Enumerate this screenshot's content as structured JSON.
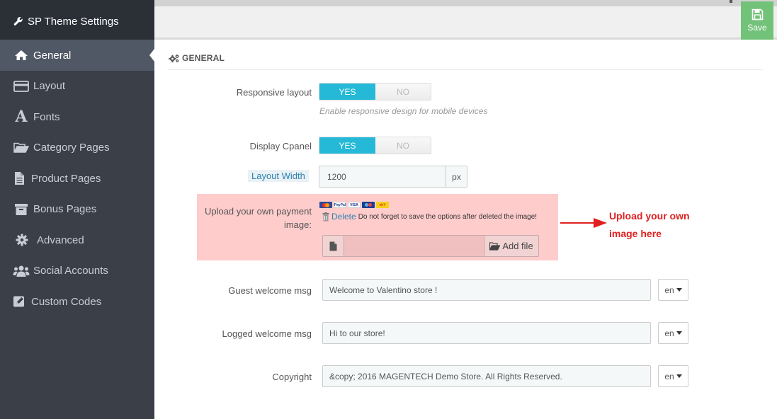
{
  "sidebar": {
    "title": "SP Theme Settings",
    "items": [
      {
        "label": "General",
        "icon": "home-icon"
      },
      {
        "label": "Layout",
        "icon": "layout-icon"
      },
      {
        "label": "Fonts",
        "icon": "font-icon"
      },
      {
        "label": "Category Pages",
        "icon": "folder-open-icon"
      },
      {
        "label": "Product Pages",
        "icon": "file-icon"
      },
      {
        "label": "Bonus Pages",
        "icon": "archive-icon"
      },
      {
        "label": "Advanced",
        "icon": "gear-icon"
      },
      {
        "label": "Social Accounts",
        "icon": "users-icon"
      },
      {
        "label": "Custom Codes",
        "icon": "edit-icon"
      }
    ]
  },
  "toolbar": {
    "save_label": "Save"
  },
  "section": {
    "title": "GENERAL"
  },
  "form": {
    "responsive": {
      "label": "Responsive layout",
      "yes": "YES",
      "no": "NO",
      "help": "Enable responsive design for mobile devices"
    },
    "cpanel": {
      "label": "Display Cpanel",
      "yes": "YES",
      "no": "NO"
    },
    "layout_width": {
      "label": "Layout Width",
      "value": "1200",
      "unit": "px"
    },
    "payment": {
      "label_line1": "Upload your own payment",
      "label_line2": "image:",
      "delete_label": "Delete",
      "note": "Do not forget to save the options after deleted the image!",
      "add_file_label": "Add file",
      "cards": [
        "",
        "PayPal",
        "VISA",
        "",
        "ebY"
      ]
    },
    "guest": {
      "label": "Guest welcome msg",
      "value": "Welcome to Valentino store !",
      "lang": "en"
    },
    "logged": {
      "label": "Logged welcome msg",
      "value": "Hi to our store!",
      "lang": "en"
    },
    "copyright": {
      "label": "Copyright",
      "value": "&copy; 2016 MAGENTECH Demo Store. All Rights Reserved.",
      "lang": "en"
    }
  },
  "annotation": {
    "line1": "Upload your own",
    "line2": "image here"
  },
  "colors": {
    "accent": "#25b9d7",
    "save": "#72c279",
    "highlight": "#ffcccc",
    "annotation": "#e02020"
  }
}
